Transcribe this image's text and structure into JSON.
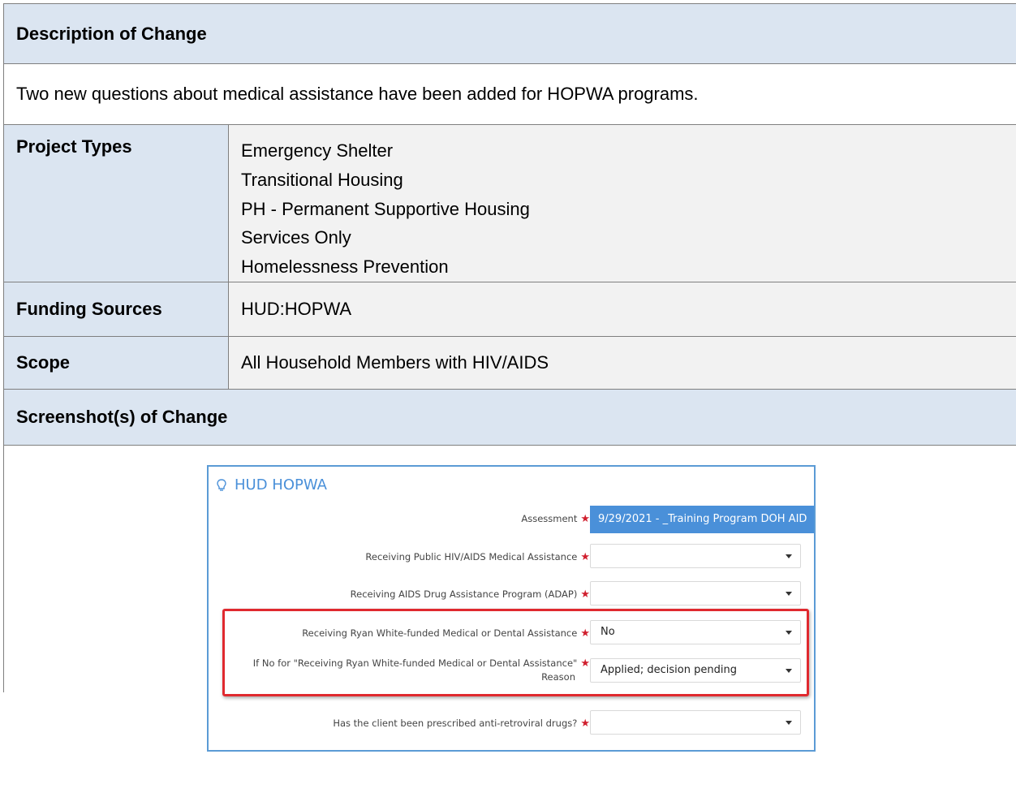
{
  "description": {
    "header": "Description of Change",
    "text": "Two new questions about medical assistance have been added for HOPWA programs."
  },
  "project_types": {
    "label": "Project Types",
    "items": [
      "Emergency Shelter",
      "Transitional Housing",
      "PH - Permanent Supportive Housing",
      "Services Only",
      "Homelessness Prevention"
    ]
  },
  "funding_sources": {
    "label": "Funding Sources",
    "value": "HUD:HOPWA"
  },
  "scope": {
    "label": "Scope",
    "value": "All Household Members with HIV/AIDS"
  },
  "screenshots": {
    "header": "Screenshot(s) of Change"
  },
  "form": {
    "title": "HUD HOPWA",
    "title_icon": "lightbulb-icon",
    "accent_color": "#4a90d9",
    "highlight_color": "#e0292f",
    "required_mark": "★",
    "assessment": {
      "label": "Assessment",
      "value": "9/29/2021 - _Training Program DOH AID"
    },
    "fields": [
      {
        "label": "Receiving Public HIV/AIDS Medical Assistance",
        "value": ""
      },
      {
        "label": "Receiving AIDS Drug Assistance Program (ADAP)",
        "value": ""
      },
      {
        "label": "Receiving Ryan White-funded Medical or Dental Assistance",
        "value": "No"
      },
      {
        "label_line1": "If No for \"Receiving Ryan White-funded Medical or Dental Assistance\"",
        "label_line2": "Reason",
        "value": "Applied; decision pending"
      },
      {
        "label": "Has the client been prescribed anti-retroviral drugs?",
        "value": ""
      }
    ]
  }
}
